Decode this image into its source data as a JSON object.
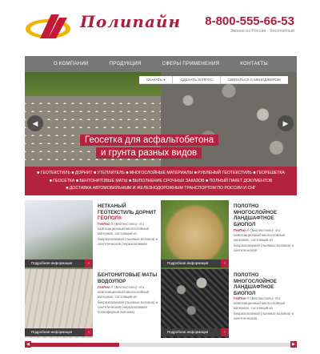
{
  "header": {
    "logo_text": "Полипайн",
    "phone": "8-800-555-66-53",
    "phone_note": "Звонок из России - бесплатный",
    "brand_color": "#b01c3a"
  },
  "nav": {
    "items": [
      "О КОМПАНИИ",
      "ПРОДУКЦИЯ",
      "СФЕРЫ ПРИМЕНЕНИЯ",
      "КОНТАКТЫ"
    ]
  },
  "hero": {
    "dropdown": [
      "СКАЧАТЬ",
      "СДЕЛАТЬ ЗАПРОС",
      "СВЯЗАТЬСЯ С МЕНЕДЖЕРОМ"
    ],
    "caption_line1": "Геосетка для асфальтобетона",
    "caption_line2": "и грунта разных видов",
    "prev_icon": "arrow-left-icon",
    "next_icon": "arrow-right-icon"
  },
  "tags": {
    "line1": "■ ГЕОТЕКСТИЛЬ ■ ДОРНИТ ■ УТЕПЛИТЕЛЬ ■ МНОГОСЛОЙНЫЕ МАТЕРИАЛЫ ■ РУБЛЕНЫЙ ГЕОТЕКСТИЛЬ ■ ГЕОРЕШЕТКА",
    "line2": "■ ГЕОСЕТКА ■ БЕНТОНИТОВЫЕ МАТЫ ■ ВЫПОЛНЕНИЕ СРОЧНЫХ ЗАКАЗОВ ■ ПОЛНЫЙ ПАКЕТ ДОКУМЕНТОВ",
    "line3": "■ ДОСТАВКА АВТОМОБИЛЬНЫМ И ЖЕЛЕЗНОДОРОЖНЫМ ТРАНСПОРТОМ ПО РОССИИ И СНГ"
  },
  "cards": [
    {
      "title_a": "НЕТКАНЫЙ ГЕОТЕКСТИЛЬ ДОРНИТ",
      "title_b": "ГЕОПОЛ",
      "text_bold": "ГеоПол",
      "text": "® (Биотекстиль)- это композиционный многослойный материал, состоящий из биоразлагаемой (льняные волокна) и синтетической (неразлагаемая",
      "more": "Подробная информация",
      "more_icon": "chevron-right-icon"
    },
    {
      "title_a": "ПОЛОТНО МНОГОСЛОЙНОЕ ЛАНДШАФТНОЕ БИОПОЛ",
      "title_b": "",
      "text_bold": "ГеоПол",
      "text": "® (Биотекстиль)- это композиционный многослойный материал, состоящий из биоразлагаемой (льняные волокна) и синтетической",
      "more": "Подробная информация",
      "more_icon": "chevron-right-icon"
    },
    {
      "title_a": "БЕНТОНИТОВЫЕ МАТЫ ВОДОУПОР",
      "title_b": "",
      "text_bold": "ГеоПол",
      "text": "® (Биотекстиль)- это композиционный многослойный материал, состоящий из биоразлагаемой (льняные волокна) и синтетической (неразлагаемая полиэфирное волокна)",
      "more": "Подробная информация",
      "more_icon": "chevron-right-icon"
    },
    {
      "title_a": "ПОЛОТНО МНОГОСЛОЙНОЕ ЛАНДШАФТНОЕ БИОПОЛ",
      "title_b": "",
      "text_bold": "ГеоПол",
      "text": "® (Биотекстиль)- это композиционный многослойный материал, состоящий из биоразлагаемой (льняные волокна) и синтетической",
      "more": "Подробная информация",
      "more_icon": "chevron-right-icon"
    }
  ],
  "slider": {
    "prev_icon": "arrow-left-icon",
    "next_icon": "arrow-right-icon"
  }
}
